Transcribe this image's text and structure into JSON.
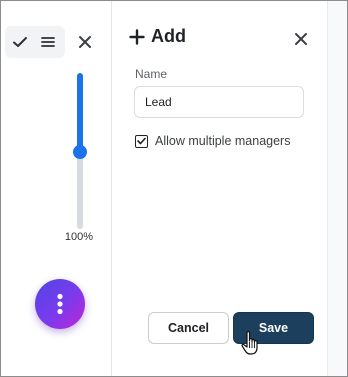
{
  "toolbar": {
    "zoom_label": "100%",
    "zoom_level_percent": 50
  },
  "dialog": {
    "title": "Add",
    "name_label": "Name",
    "name_value": "Lead",
    "allow_multiple_label": "Allow multiple managers",
    "allow_multiple_checked": true,
    "cancel_label": "Cancel",
    "save_label": "Save"
  },
  "icons": {
    "check": "check-icon",
    "menu": "menu-icon",
    "close": "close-icon",
    "plus": "plus-icon",
    "more": "more-vertical-icon",
    "cursor": "hand-pointer-icon"
  },
  "colors": {
    "accent": "#1a73e8",
    "save_button": "#1d3f5e",
    "fab_gradient_start": "#4f46e5",
    "fab_gradient_end": "#c026d3"
  }
}
